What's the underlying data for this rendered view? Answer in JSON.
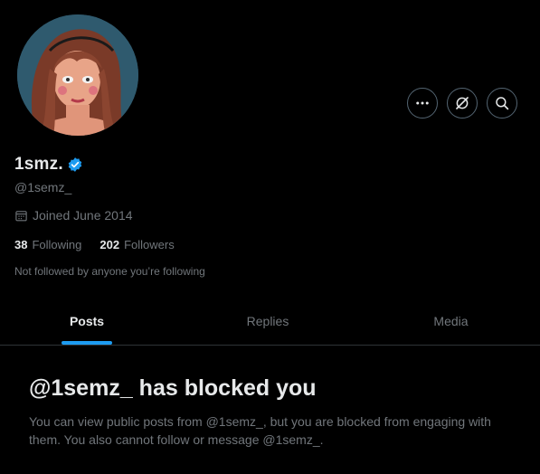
{
  "profile": {
    "display_name": "1smz.",
    "handle": "@1semz_",
    "joined": "Joined June 2014",
    "following_count": "38",
    "following_label": "Following",
    "followers_count": "202",
    "followers_label": "Followers",
    "followed_note": "Not followed by anyone you’re following",
    "verified": true
  },
  "actions": [
    {
      "icon": "more-icon"
    },
    {
      "icon": "grok-icon"
    },
    {
      "icon": "search-icon"
    }
  ],
  "tabs": [
    {
      "label": "Posts",
      "active": true
    },
    {
      "label": "Replies",
      "active": false
    },
    {
      "label": "Media",
      "active": false
    }
  ],
  "blocked": {
    "title": "@1semz_ has blocked you",
    "body": "You can view public posts from @1semz_, but you are blocked from engaging with them. You also cannot follow or message @1semz_."
  },
  "colors": {
    "background": "#000000",
    "text_primary": "#e7e9ea",
    "text_secondary": "#71767b",
    "accent": "#1d9bf0",
    "border": "#2f3336"
  }
}
